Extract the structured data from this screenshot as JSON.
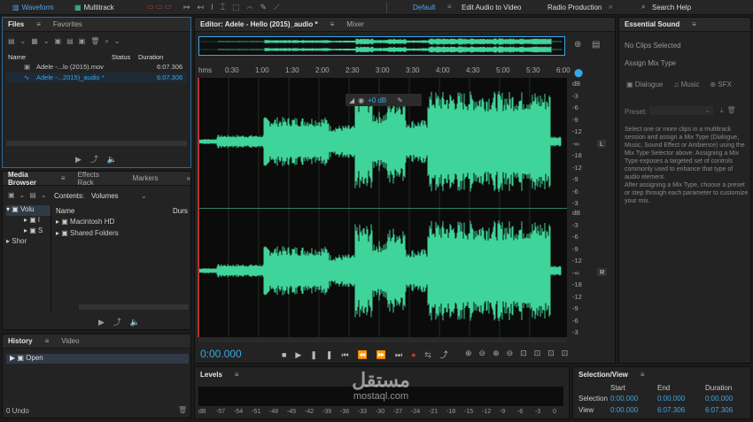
{
  "toolbar": {
    "waveform": "Waveform",
    "multitrack": "Multitrack",
    "workspaces": [
      "Default",
      "Edit Audio to Video",
      "Radio Production"
    ],
    "search": "Search Help",
    "colors": {
      "accent": "#38a7e8",
      "waveform": "#3fd49a"
    }
  },
  "files": {
    "tabs": [
      "Files",
      "Favorites"
    ],
    "headers": [
      "Name",
      "Status",
      "Duration"
    ],
    "rows": [
      {
        "name": "Adele -...lo (2015).mov",
        "duration": "6:07.306"
      },
      {
        "name": "Adele -...2015)_audio *",
        "duration": "6:07.306"
      }
    ]
  },
  "media": {
    "tabs": [
      "Media Browser",
      "Effects Rack",
      "Markers"
    ],
    "contents_label": "Contents:",
    "contents_value": "Volumes",
    "left_items": [
      "Volu",
      "l",
      "S",
      "Shor"
    ],
    "col_name": "Name",
    "col_dur": "Durs",
    "items": [
      "Macintosh HD",
      "Shared Folders"
    ]
  },
  "history": {
    "tabs": [
      "History",
      "Video"
    ],
    "items": [
      "Open"
    ],
    "undo": "0 Undo"
  },
  "editor": {
    "tab": "Editor: Adele - Hello (2015)_audio *",
    "mixer": "Mixer",
    "ruler_unit": "hms",
    "ruler": [
      "0:30",
      "1:00",
      "1:30",
      "2:00",
      "2:30",
      "3:00",
      "3:30",
      "4:00",
      "4:30",
      "5:00",
      "5:30",
      "6:00"
    ],
    "db_top": [
      "dB",
      "-3",
      "-6",
      "-9",
      "-12",
      "-∞",
      "-18",
      "-12",
      "-9",
      "-6",
      "-3"
    ],
    "db_bot": [
      "dB",
      "-3",
      "-6",
      "-9",
      "-12",
      "-∞",
      "-18",
      "-12",
      "-9",
      "-6",
      "-3"
    ],
    "channels": [
      "L",
      "R"
    ],
    "hud_value": "+0 dB",
    "time": "0:00.000"
  },
  "levels": {
    "title": "Levels",
    "scale": [
      "dB",
      "-57",
      "-54",
      "-51",
      "-48",
      "-45",
      "-42",
      "-39",
      "-36",
      "-33",
      "-30",
      "-27",
      "-24",
      "-21",
      "-18",
      "-15",
      "-12",
      "-9",
      "-6",
      "-3",
      "0"
    ]
  },
  "essential": {
    "title": "Essential Sound",
    "no_clips": "No Clips Selected",
    "assign": "Assign Mix Type",
    "types": [
      "Dialogue",
      "Music",
      "SFX"
    ],
    "preset": "Preset:",
    "desc1": "Select one or more clips in a multitrack session and assign a Mix Type (Dialogue, Music, Sound Effect or Ambience) using the Mix Type Selector above. Assigning a Mix Type exposes a targeted set of controls commonly used to enhance that type of audio element.",
    "desc2": "After assigning a Mix Type, choose a preset or step through each parameter to customize your mix."
  },
  "selection": {
    "title": "Selection/View",
    "headers": [
      "Start",
      "End",
      "Duration"
    ],
    "rows": [
      {
        "label": "Selection",
        "start": "0:00.000",
        "end": "0:00.000",
        "dur": "0:00.000"
      },
      {
        "label": "View",
        "start": "0:00.000",
        "end": "6:07.306",
        "dur": "6:07.306"
      }
    ]
  },
  "watermark": {
    "arabic": "مستقل",
    "latin": "mostaql.com"
  }
}
